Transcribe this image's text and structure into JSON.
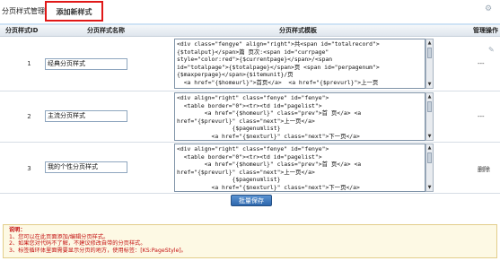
{
  "tabs": {
    "manager": "分页样式管理",
    "add": "添加新样式"
  },
  "table": {
    "headers": {
      "id": "分页样式ID",
      "name": "分页样式名称",
      "template": "分页样式模板",
      "op": "管理操作"
    },
    "rows": [
      {
        "id": "1",
        "name": "经典分页样式",
        "template": "<div class=\"fengye\" align=\"right\">共<span id=\"totalrecord\">\n{$totalput}</span>篇 页次:<span id=\"currpage\"\nstyle=\"color:red\">{$currentpage}</span>/<span\nid=\"totalpage\">{$totalpage}</span>页 <span id=\"perpagenum\">\n{$maxperpage}</span>{$itemunit}/页\n  <a href=\"{$homeurl}\">首页</a>  <a href=\"{$prevurl}\">上一页",
        "op": "---"
      },
      {
        "id": "2",
        "name": "主流分页样式",
        "template": "<div align=\"right\" class=\"fenye\" id=\"fenye\">\n  <table border=\"0\"><tr><td id=\"pagelist\">\n        <a href=\"{$homeurl}\" class=\"prev\">首 页</a> <a\nhref=\"{$prevurl}\" class=\"next\">上一页</a>\n                {$pagenumlist}\n          <a href=\"{$nexturl}\" class=\"next\">下一页</a>",
        "op": "---"
      },
      {
        "id": "3",
        "name": "我的个性分页样式",
        "template": "<div align=\"right\" class=\"fenye\" id=\"fenye\">\n  <table border=\"0\"><tr><td id=\"pagelist\">\n        <a href=\"{$homeurl}\" class=\"prev\">首 页</a> <a\nhref=\"{$prevurl}\" class=\"next\">上一页</a>\n                {$pagenumlist}\n          <a href=\"{$nexturl}\" class=\"next\">下一页</a>",
        "op": "删除"
      }
    ]
  },
  "save_label": "批量保存",
  "note": {
    "title": "说明：",
    "lines": [
      "1、您可以在此页面添加/编辑分页样式。",
      "2、如果您对代码不了解，不建议修改自带的分页样式。",
      "3、标签循环体里面需要显示分页的地方，使用标签：[KS:PageStyle]。"
    ]
  },
  "icons": [
    "gear-icon",
    "pin-icon",
    "scroll-up-icon",
    "scroll-down-icon"
  ]
}
